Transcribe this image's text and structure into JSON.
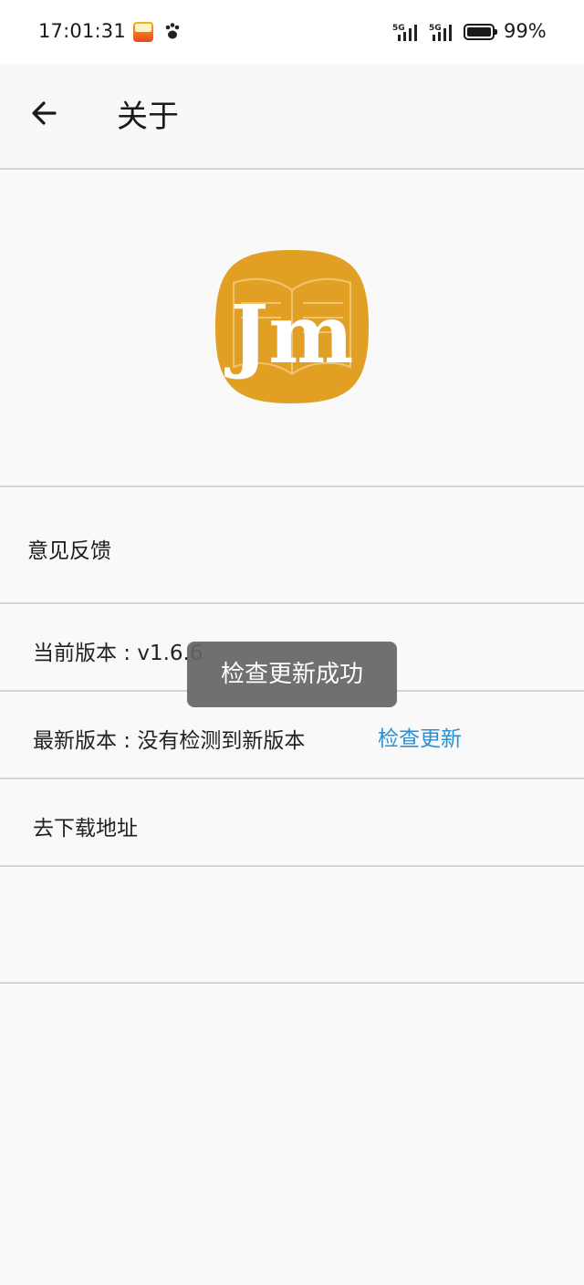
{
  "status_bar": {
    "time": "17:01:31",
    "battery_percent": "99%",
    "network_1": "5G",
    "network_2": "5G"
  },
  "app_bar": {
    "title": "关于",
    "back_icon": "arrow-left-icon"
  },
  "logo": {
    "text": "Jm",
    "background_color": "#e1a023",
    "icon": "open-book-icon"
  },
  "items": {
    "feedback_label": "意见反馈",
    "current_version": "当前版本 : v1.6.6",
    "latest_version": "最新版本 : 没有检测到新版本",
    "check_update_label": "检查更新",
    "download_link_label": "去下载地址"
  },
  "toast": {
    "message": "检查更新成功"
  },
  "colors": {
    "link": "#2b8fd6",
    "divider": "#d3d3dc",
    "background": "#f9f9f9"
  }
}
